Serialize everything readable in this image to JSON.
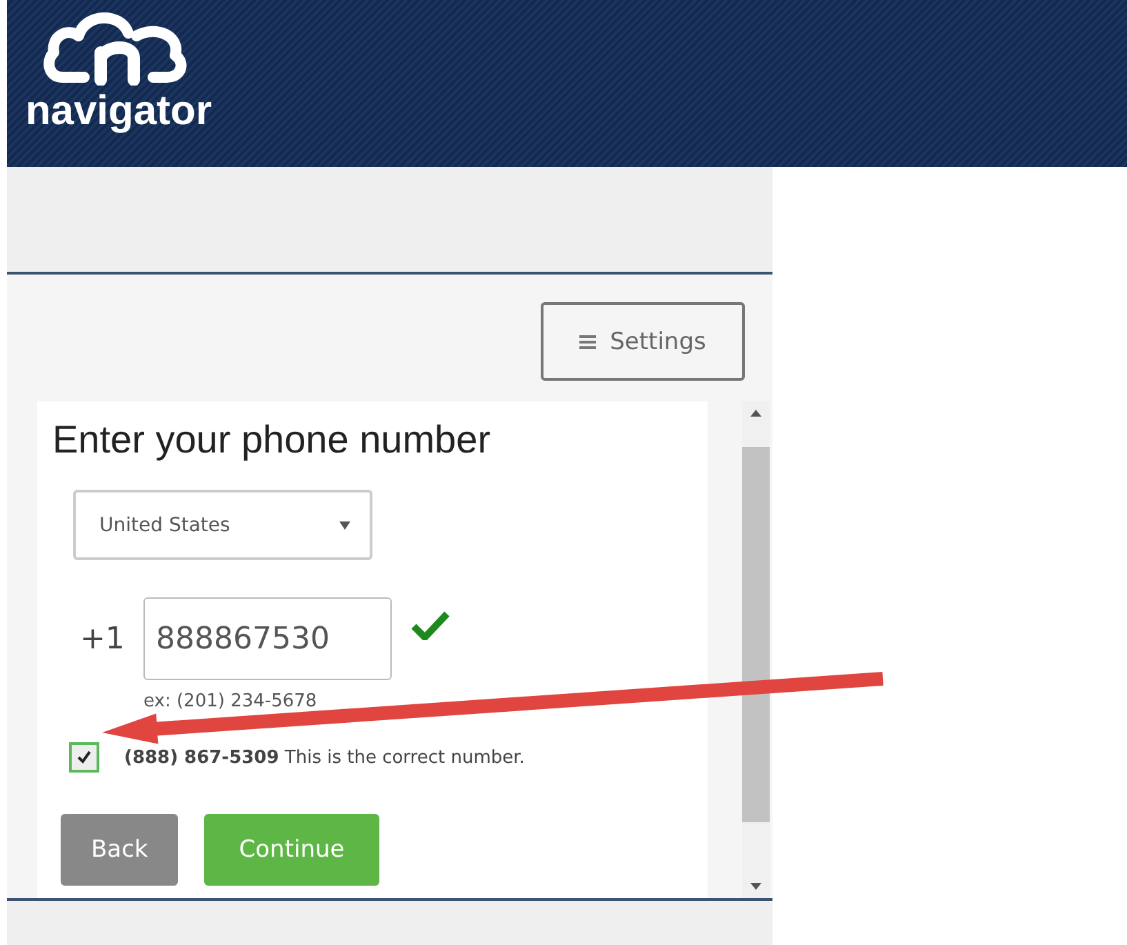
{
  "header": {
    "brand": "navigator"
  },
  "settings_button": {
    "label": "Settings"
  },
  "form": {
    "title": "Enter your phone number",
    "country": {
      "value": "United States"
    },
    "dial_code": "+1",
    "phone": {
      "value": "888867530",
      "valid": true
    },
    "hint": "ex: (201) 234-5678",
    "confirm": {
      "checked": true,
      "text": "**(888) 867-5309** This is the correct number."
    },
    "buttons": [
      {
        "label": "Back",
        "kind": "secondary"
      },
      {
        "label": "Continue",
        "kind": "primary"
      }
    ]
  }
}
